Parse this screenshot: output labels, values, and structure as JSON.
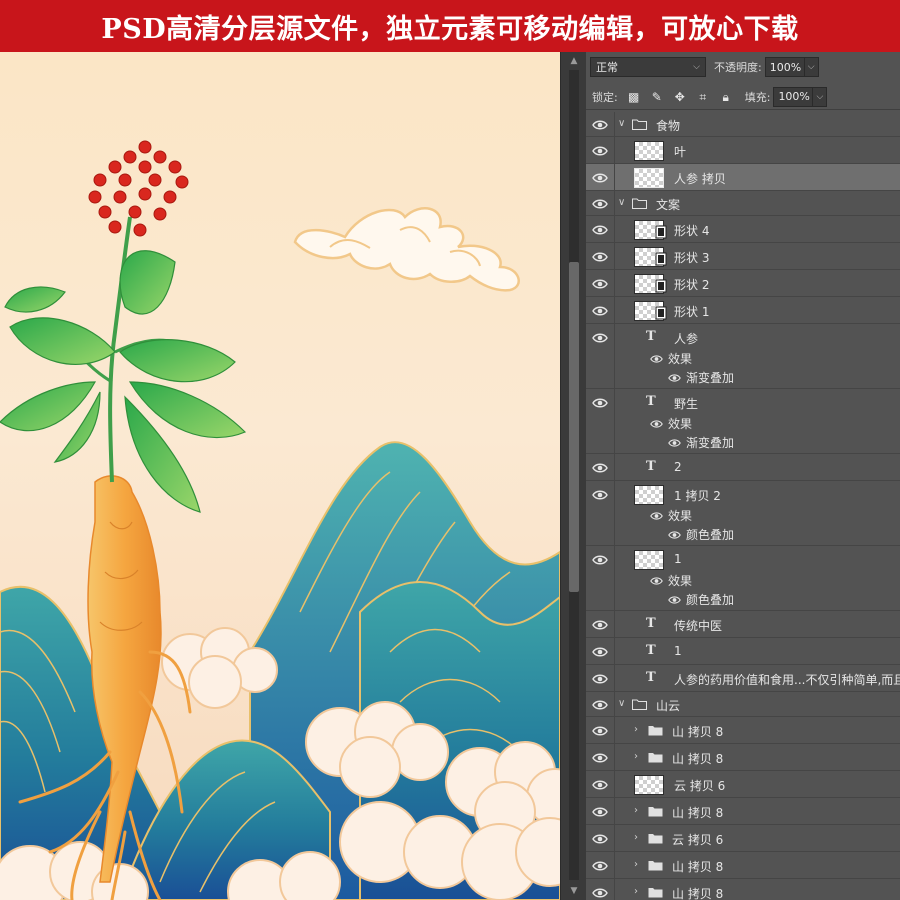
{
  "banner": {
    "text": "PSD高清分层源文件，独立元素可移动编辑，可放心下载"
  },
  "panel": {
    "blend_mode": "正常",
    "opacity_label": "不透明度:",
    "opacity_value": "100%",
    "lock_label": "锁定:",
    "fill_label": "填充:",
    "fill_value": "100%",
    "layers": [
      {
        "type": "group",
        "name": "食物",
        "indent": 0,
        "open": true
      },
      {
        "type": "pixel",
        "name": "叶",
        "indent": 1
      },
      {
        "type": "pixel",
        "name": "人参 拷贝",
        "indent": 1,
        "selected": true
      },
      {
        "type": "group",
        "name": "文案",
        "indent": 0,
        "open": true
      },
      {
        "type": "shape",
        "name": "形状 4",
        "indent": 1
      },
      {
        "type": "shape",
        "name": "形状 3",
        "indent": 1
      },
      {
        "type": "shape",
        "name": "形状 2",
        "indent": 1
      },
      {
        "type": "shape",
        "name": "形状 1",
        "indent": 1
      },
      {
        "type": "text",
        "name": "人参",
        "indent": 1,
        "effects_label": "效果",
        "effect": "渐变叠加"
      },
      {
        "type": "text",
        "name": "野生",
        "indent": 1,
        "effects_label": "效果",
        "effect": "渐变叠加"
      },
      {
        "type": "text",
        "name": "2",
        "indent": 1
      },
      {
        "type": "pixel",
        "name": "1 拷贝 2",
        "indent": 1,
        "effects_label": "效果",
        "effect": "颜色叠加"
      },
      {
        "type": "pixel",
        "name": "1",
        "indent": 1,
        "effects_label": "效果",
        "effect": "颜色叠加"
      },
      {
        "type": "text",
        "name": "传统中医",
        "indent": 1
      },
      {
        "type": "text",
        "name": "1",
        "indent": 1
      },
      {
        "type": "text",
        "name": "人参的药用价值和食用...不仅引种简单,而且",
        "indent": 1
      },
      {
        "type": "group",
        "name": "山云",
        "indent": 0,
        "open": true
      },
      {
        "type": "group",
        "name": "山 拷贝 8",
        "indent": 1,
        "open": false
      },
      {
        "type": "group",
        "name": "山 拷贝 8",
        "indent": 1,
        "open": false
      },
      {
        "type": "pixel",
        "name": "云 拷贝 6",
        "indent": 1
      },
      {
        "type": "group",
        "name": "山 拷贝 8",
        "indent": 1,
        "open": false
      },
      {
        "type": "group",
        "name": "云 拷贝 6",
        "indent": 1,
        "open": false
      },
      {
        "type": "group",
        "name": "山 拷贝 8",
        "indent": 1,
        "open": false
      },
      {
        "type": "group",
        "name": "山 拷贝 8",
        "indent": 1,
        "open": false
      }
    ]
  },
  "colors": {
    "banner_bg": "#c8151b",
    "panel_bg": "#535353",
    "mountain_teal": "#2a8a9a",
    "mountain_blue": "#1f5fa0",
    "ginseng": "#f4a94a",
    "berry": "#d9271e",
    "leaf": "#3fb55a"
  }
}
